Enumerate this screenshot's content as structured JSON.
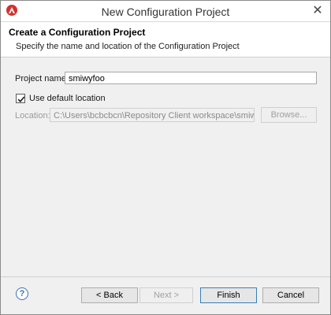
{
  "window": {
    "title": "New Configuration Project"
  },
  "header": {
    "title": "Create a Configuration Project",
    "description": "Specify the name and location of the Configuration Project"
  },
  "form": {
    "project_name_label": "Project name:",
    "project_name_value": "smiwyfoo",
    "use_default_label": "Use default location",
    "use_default_checked": true,
    "location_label": "Location:",
    "location_value": "C:\\Users\\bcbcbcn\\Repository Client workspace\\smiwyfoo",
    "browse_label": "Browse..."
  },
  "footer": {
    "help_icon": "?",
    "back_label": "< Back",
    "next_label": "Next >",
    "finish_label": "Finish",
    "cancel_label": "Cancel"
  },
  "icons": {
    "app": "app-logo-icon",
    "close": "close-icon",
    "help": "help-icon",
    "check": "checkmark-icon"
  },
  "colors": {
    "accent": "#3c7fb1",
    "app_icon": "#d2322d"
  }
}
